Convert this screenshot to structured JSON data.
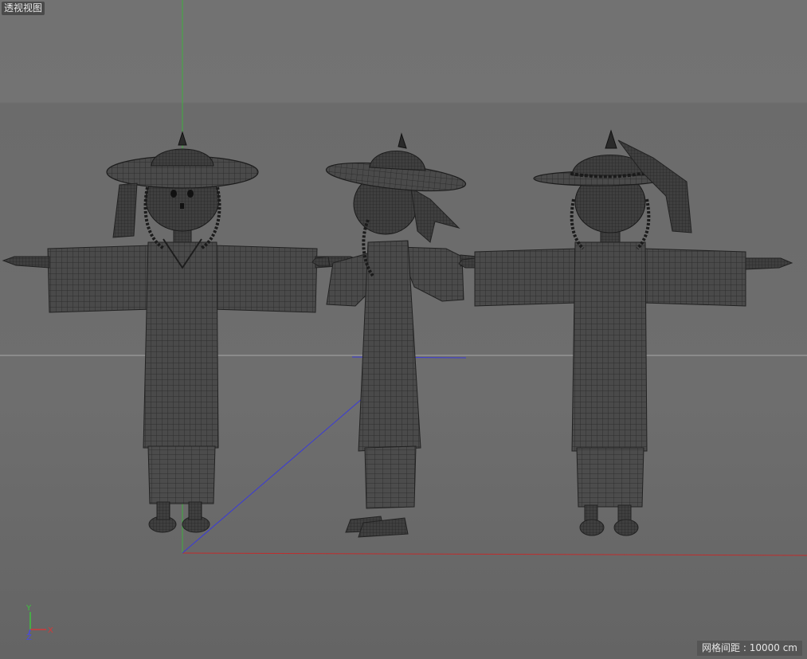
{
  "viewport": {
    "view_name": "透视视图",
    "grid_spacing_label": "网格间距 : 10000 cm"
  },
  "axis_gizmo": {
    "y_label": "Y",
    "x_label": "X",
    "z_label": "Z",
    "x_color": "#d03a3a",
    "y_color": "#3fc23f",
    "z_color": "#4a4ae0"
  },
  "scene": {
    "characters": [
      {
        "view": "front"
      },
      {
        "view": "side"
      },
      {
        "view": "back"
      }
    ],
    "colors": {
      "mesh_fill": "#444444",
      "mesh_wire": "#262626",
      "horizon": "#a8a8a8"
    }
  }
}
